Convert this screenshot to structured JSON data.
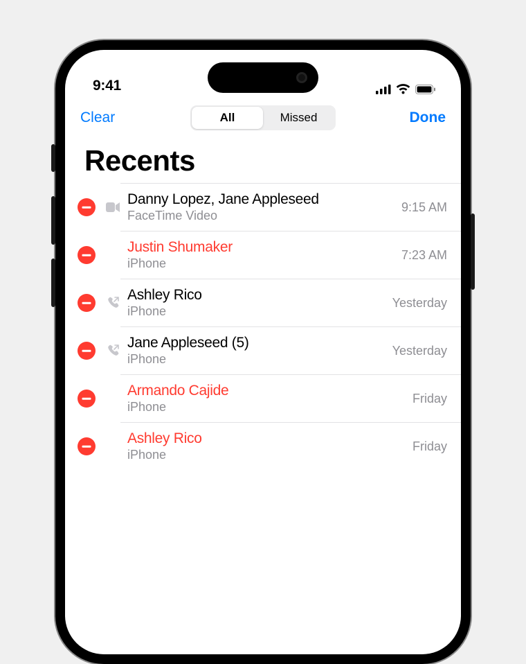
{
  "status": {
    "time": "9:41"
  },
  "nav": {
    "left": "Clear",
    "right": "Done"
  },
  "segments": {
    "all": "All",
    "missed": "Missed",
    "active": "all"
  },
  "title": "Recents",
  "calls": [
    {
      "name": "Danny Lopez, Jane Appleseed",
      "sub": "FaceTime Video",
      "time": "9:15 AM",
      "missed": false,
      "icon": "facetime"
    },
    {
      "name": "Justin Shumaker",
      "sub": "iPhone",
      "time": "7:23 AM",
      "missed": true,
      "icon": "none"
    },
    {
      "name": "Ashley Rico",
      "sub": "iPhone",
      "time": "Yesterday",
      "missed": false,
      "icon": "outgoing"
    },
    {
      "name": "Jane Appleseed (5)",
      "sub": "iPhone",
      "time": "Yesterday",
      "missed": false,
      "icon": "outgoing"
    },
    {
      "name": "Armando Cajide",
      "sub": "iPhone",
      "time": "Friday",
      "missed": true,
      "icon": "none"
    },
    {
      "name": "Ashley Rico",
      "sub": "iPhone",
      "time": "Friday",
      "missed": true,
      "icon": "none"
    }
  ]
}
